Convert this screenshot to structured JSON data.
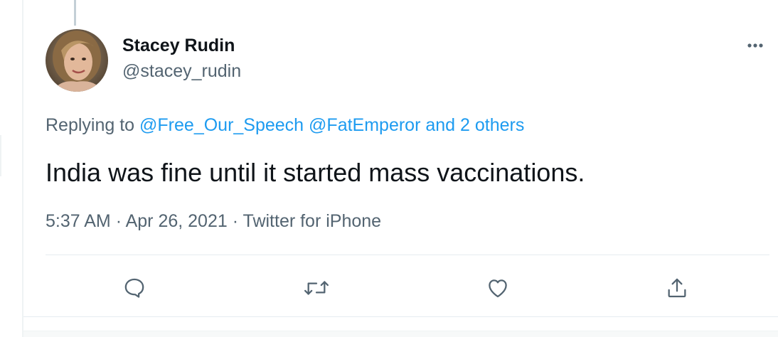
{
  "author": {
    "display_name": "Stacey Rudin",
    "handle": "@stacey_rudin",
    "avatar_icon": "user-photo"
  },
  "replying": {
    "prefix": "Replying to",
    "mention_1": "@Free_Our_Speech",
    "mention_2": "@FatEmperor",
    "others": "and 2 others"
  },
  "tweet": {
    "text": "India was fine until it started mass vaccinations."
  },
  "meta": {
    "time": "5:37 AM",
    "separator_1": "·",
    "date": "Apr 26, 2021",
    "separator_2": "·",
    "source": "Twitter for iPhone"
  },
  "actions": {
    "reply_icon": "speech-bubble-icon",
    "retweet_icon": "retweet-icon",
    "like_icon": "heart-icon",
    "share_icon": "share-icon"
  },
  "colors": {
    "text_primary": "#0f1419",
    "text_secondary": "#536471",
    "link_blue": "#1d9bf0",
    "icon_gray": "#536471"
  }
}
